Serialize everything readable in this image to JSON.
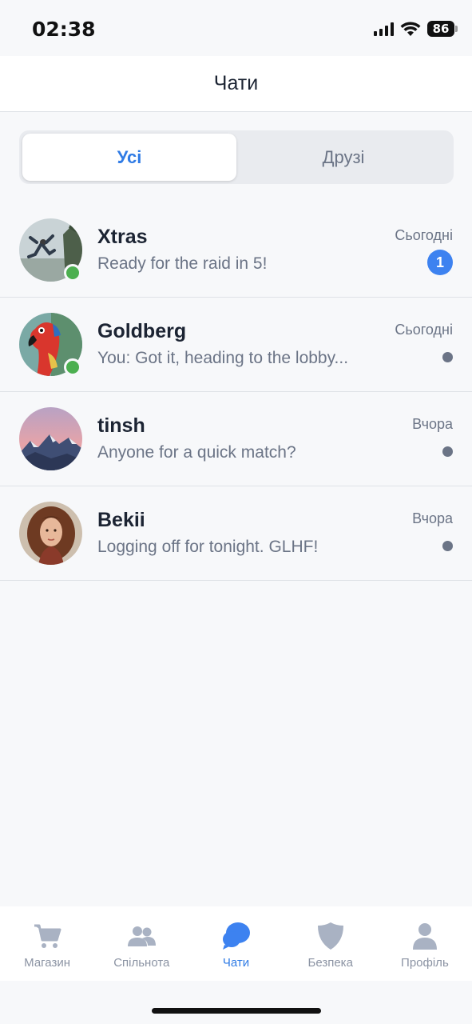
{
  "status_bar": {
    "time": "02:38",
    "battery": "86",
    "icons": [
      "cellular-signal-icon",
      "wifi-icon",
      "battery-icon"
    ]
  },
  "header": {
    "title": "Чати"
  },
  "segmented": {
    "options": [
      {
        "label": "Усі",
        "selected": true
      },
      {
        "label": "Друзі",
        "selected": false
      }
    ]
  },
  "chats": [
    {
      "name": "Xtras",
      "preview": "Ready for the raid in 5!",
      "time": "Сьогодні",
      "online": true,
      "unread": "1",
      "avatar": "jumper-photo"
    },
    {
      "name": "Goldberg",
      "preview": "You: Got it, heading to the lobby...",
      "time": "Сьогодні",
      "online": true,
      "unread": null,
      "avatar": "parrot-photo"
    },
    {
      "name": "tinsh",
      "preview": "Anyone for a quick match?",
      "time": "Вчора",
      "online": false,
      "unread": null,
      "avatar": "mountain-photo"
    },
    {
      "name": "Bekii",
      "preview": "Logging off for tonight. GLHF!",
      "time": "Вчора",
      "online": false,
      "unread": null,
      "avatar": "portrait-photo"
    }
  ],
  "tab_bar": {
    "tabs": [
      {
        "label": "Магазин",
        "icon": "cart-icon",
        "active": false
      },
      {
        "label": "Спільнота",
        "icon": "people-icon",
        "active": false
      },
      {
        "label": "Чати",
        "icon": "chat-bubbles-icon",
        "active": true
      },
      {
        "label": "Безпека",
        "icon": "shield-icon",
        "active": false
      },
      {
        "label": "Профіль",
        "icon": "person-icon",
        "active": false
      }
    ]
  },
  "colors": {
    "accent": "#2f7be5",
    "badge": "#3d82f0",
    "online": "#4caf50",
    "muted": "#6b7486",
    "tab_inactive": "#a9b2c3"
  }
}
